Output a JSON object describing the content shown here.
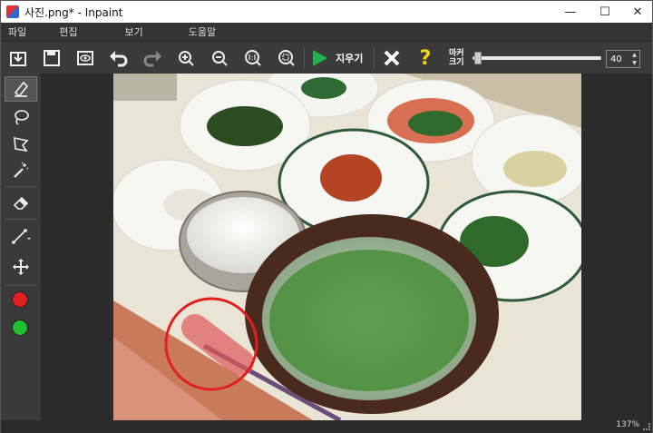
{
  "window": {
    "title": "사진.png* - Inpaint"
  },
  "window_controls": {
    "minimize": "—",
    "maximize": "☐",
    "close": "✕"
  },
  "menu": {
    "items": [
      "파일",
      "편집",
      "보기",
      "도움말"
    ]
  },
  "toolbar": {
    "run_label": "지우기",
    "marker_label_line1": "마커",
    "marker_label_line2": "크기",
    "marker_size": "40",
    "marker_slider_level": 0.03
  },
  "status": {
    "zoom": "137%"
  },
  "colors": {
    "accent_run": "#22b14c",
    "help": "#f2d21a",
    "red_marker": "#e02020",
    "green_marker": "#20c030"
  }
}
